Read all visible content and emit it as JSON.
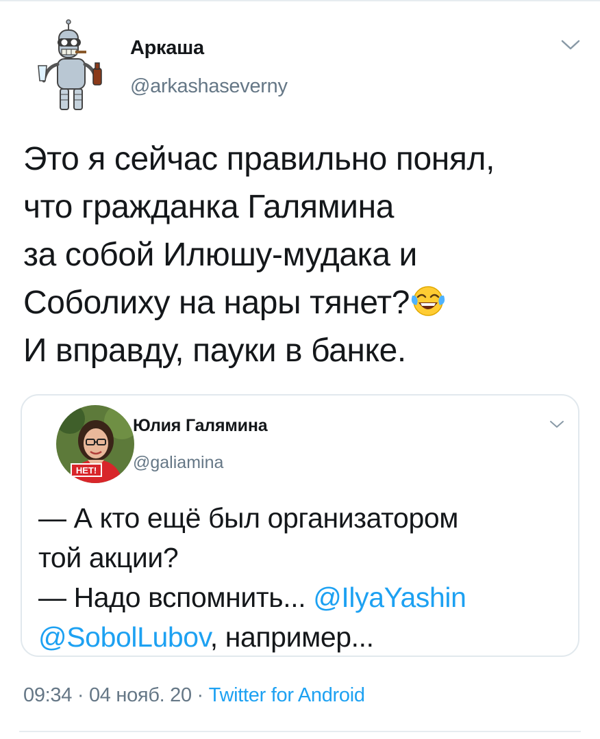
{
  "author": {
    "name": "Аркаша",
    "handle": "@arkashaseverny"
  },
  "tweet": {
    "lines": [
      "Это я сейчас правильно понял,",
      "что гражданка Галямина",
      "за собой Илюшу-мудака и",
      "Соболиху на нары тянет?",
      "И вправду, пауки в банке."
    ],
    "emoji": "face-with-tears-of-joy"
  },
  "quoted": {
    "name": "Юлия Галямина",
    "handle": "@galiamina",
    "avatar_badge": "НЕТ!",
    "line1": "— А кто ещё был организатором",
    "line2": "той акции?",
    "line3_prefix": "— Надо вспомнить... ",
    "mention1": "@IlyaYashin",
    "mention2": "@SobolLubov",
    "line4_suffix": ", например..."
  },
  "meta": {
    "time": "09:34",
    "sep1": " · ",
    "date": "04 нояб. 20",
    "sep2": " · ",
    "source": "Twitter for Android"
  },
  "colors": {
    "link": "#1da1f2",
    "secondary_text": "#657786",
    "border": "#e1e8ed"
  }
}
